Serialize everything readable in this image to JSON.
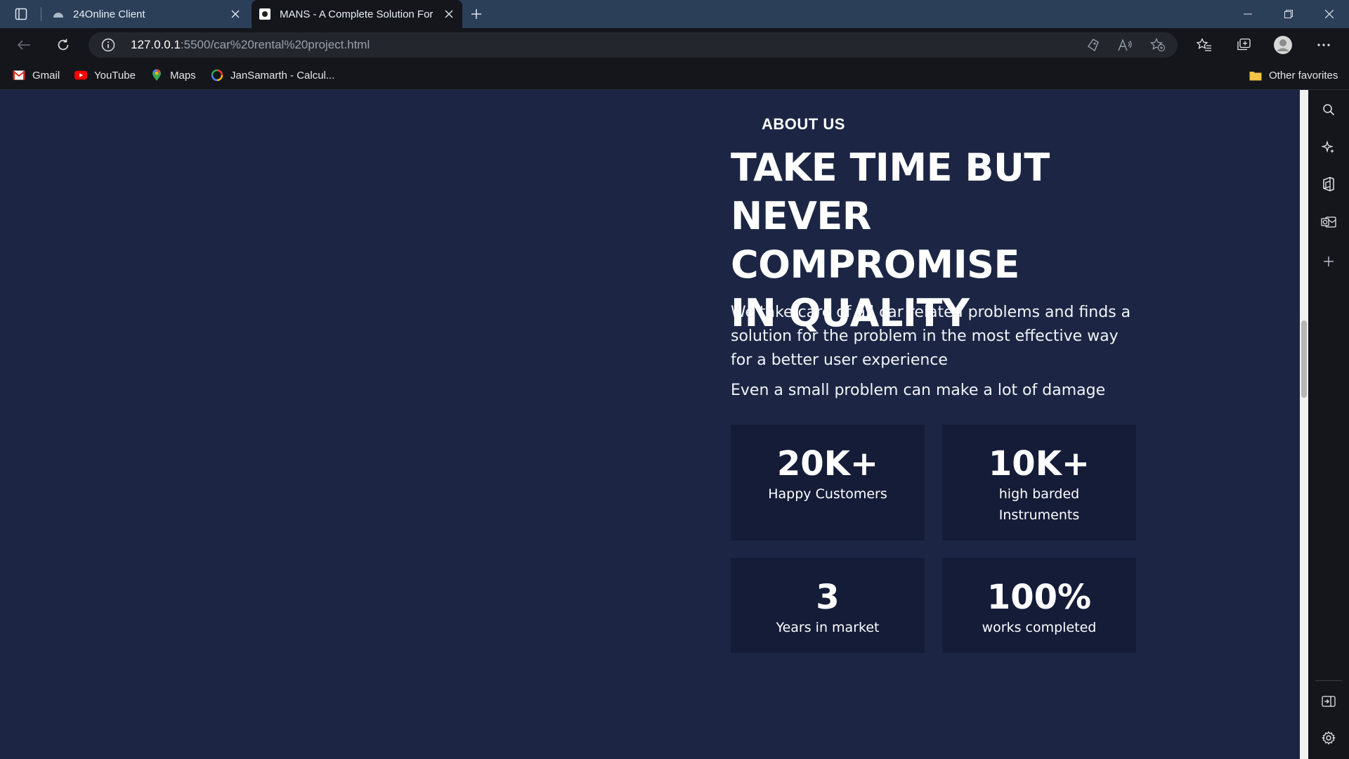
{
  "browser": {
    "tabs": [
      {
        "title": "24Online Client",
        "active": false
      },
      {
        "title": "MANS - A Complete Solution For",
        "active": true
      }
    ],
    "url_host": "127.0.0.1",
    "url_path": ":5500/car%20rental%20project.html",
    "favorites": [
      {
        "label": "Gmail",
        "icon": "gmail-icon"
      },
      {
        "label": "YouTube",
        "icon": "youtube-icon"
      },
      {
        "label": "Maps",
        "icon": "maps-icon"
      },
      {
        "label": "JanSamarth - Calcul...",
        "icon": "jansamarth-icon"
      }
    ],
    "other_favorites": "Other favorites"
  },
  "about": {
    "eyebrow": "ABOUT US",
    "heading_lines": [
      "TAKE TIME BUT",
      "NEVER COMPROMISE",
      "IN QUALITY"
    ],
    "paragraph1": "We take care of all car related problems and finds a solution for the problem in the most effective way for a better user experience",
    "paragraph2": "Even a small problem can make a lot of damage"
  },
  "stats": [
    {
      "value": "20K+",
      "label": "Happy Customers"
    },
    {
      "value": "10K+",
      "label": "high barded Instruments"
    },
    {
      "value": "3",
      "label": "Years in market"
    },
    {
      "value": "100%",
      "label": "works completed"
    }
  ],
  "colors": {
    "page_bg": "#1c2644",
    "card_bg": "#141c38",
    "titlebar_bg": "#2c3f58",
    "toolbar_bg": "#14161c"
  }
}
